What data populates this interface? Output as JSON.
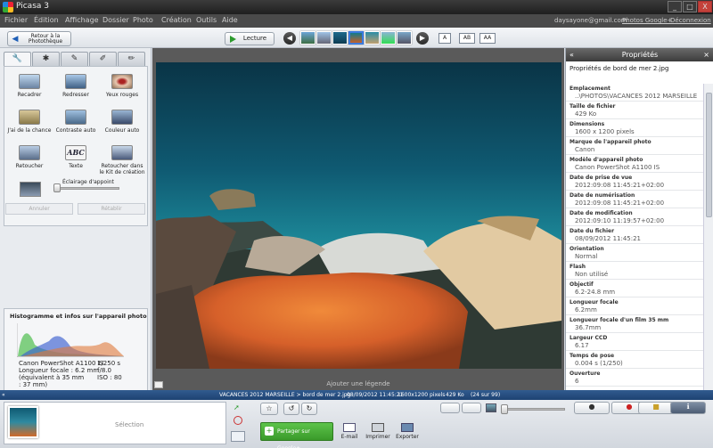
{
  "window": {
    "app_title": "Picasa 3",
    "btn_min": "_",
    "btn_max": "□",
    "btn_close": "X"
  },
  "menu": {
    "items": [
      "Fichier",
      "Édition",
      "Affichage",
      "Dossier",
      "Photo",
      "Création",
      "Outils",
      "Aide"
    ],
    "email": "daysayone@gmail.com",
    "google_link": "Photos Google+",
    "logout": "Déconnexion"
  },
  "toolbar": {
    "back_label": "Retour à la Photothèque",
    "slideshow_label": "Lecture",
    "caption_buttons": [
      "A",
      "AB",
      "AA"
    ],
    "prev": "◀",
    "next": "▶"
  },
  "left": {
    "tab_icons": [
      "wrench-icon",
      "sun-icon",
      "brush-icon",
      "brush-effects-icon",
      "brush-more-icon"
    ],
    "tab_glyphs": [
      "🔧",
      "✱",
      "✎",
      "✐",
      "✏"
    ],
    "tools": [
      {
        "label": "Recadrer"
      },
      {
        "label": "Redresser"
      },
      {
        "label": "Yeux rouges"
      },
      {
        "label": "J'ai de la chance"
      },
      {
        "label": "Contraste auto"
      },
      {
        "label": "Couleur auto"
      },
      {
        "label": "Retoucher"
      },
      {
        "label": "Texte"
      },
      {
        "label": "Retoucher dans le Kit de création"
      }
    ],
    "fill_light_label": "Éclairage d'appoint",
    "fill_light_value": 0.0,
    "undo_label": "Annuler",
    "redo_label": "Rétablir",
    "histogram_title": "Histogramme et infos sur l'appareil photo",
    "cam": {
      "model": "Canon PowerShot A1100 IS",
      "focal": "Longueur focale : 6.2 mm",
      "equiv": "(équivalent à 35 mm : 37 mm)",
      "shutter": "1/250 s",
      "aperture": "f/8.0",
      "iso": "ISO : 80"
    }
  },
  "viewer": {
    "caption_placeholder": "Ajouter une légende"
  },
  "right": {
    "header": "Propriétés",
    "title": "Propriétés de bord de mer 2.jpg",
    "props": [
      {
        "k": "Emplacement",
        "v": "..\\PHOTOS\\VACANCES 2012 MARSEILLE"
      },
      {
        "k": "Taille de fichier",
        "v": "429 Ko"
      },
      {
        "k": "Dimensions",
        "v": "1600 x 1200 pixels"
      },
      {
        "k": "Marque de l'appareil photo",
        "v": "Canon"
      },
      {
        "k": "Modèle d'appareil photo",
        "v": "Canon PowerShot A1100 IS"
      },
      {
        "k": "Date de prise de vue",
        "v": "2012:09:08 11:45:21+02:00"
      },
      {
        "k": "Date de numérisation",
        "v": "2012:09:08 11:45:21+02:00"
      },
      {
        "k": "Date de modification",
        "v": "2012:09:10 11:19:57+02:00"
      },
      {
        "k": "Date du fichier",
        "v": "08/09/2012 11:45:21"
      },
      {
        "k": "Orientation",
        "v": "Normal"
      },
      {
        "k": "Flash",
        "v": "Non utilisé"
      },
      {
        "k": "Objectif",
        "v": "6.2-24.8 mm"
      },
      {
        "k": "Longueur focale",
        "v": "6.2mm"
      },
      {
        "k": "Longueur focale d'un film 35 mm",
        "v": "36.7mm"
      },
      {
        "k": "Largeur CCD",
        "v": "6.17"
      },
      {
        "k": "Temps de pose",
        "v": "0.004 s (1/250)"
      },
      {
        "k": "Ouverture",
        "v": "6"
      }
    ]
  },
  "status": {
    "path": "VACANCES 2012 MARSEILLE > bord de mer 2.jpg",
    "date": "08/09/2012 11:45:21",
    "dims": "1600x1200 pixels",
    "size": "429 Ko",
    "index": "(24 sur 99)"
  },
  "bottom": {
    "selection": "Sélection",
    "share": "Partager sur Google+",
    "email": "E-mail",
    "print": "Imprimer",
    "export": "Exporter"
  },
  "colors": {
    "status_bar": "#2a4f82",
    "share_green": "#4aaf39"
  }
}
